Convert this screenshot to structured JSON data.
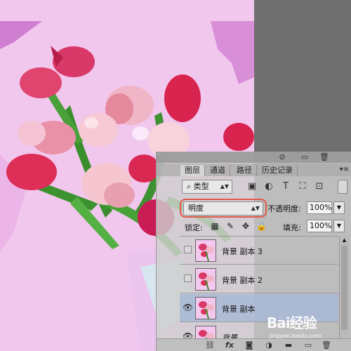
{
  "panel": {
    "tabs": [
      {
        "label": "图层",
        "active": true
      },
      {
        "label": "通道",
        "active": false
      },
      {
        "label": "路径",
        "active": false
      },
      {
        "label": "历史记录",
        "active": false
      }
    ],
    "filter": {
      "label": "类型"
    },
    "blend_mode": "明度",
    "opacity": {
      "label": "不透明度:",
      "value": "100%"
    },
    "lock": {
      "label": "锁定:"
    },
    "fill": {
      "label": "填充:",
      "value": "100%"
    },
    "layers": [
      {
        "name": "背景 副本 3",
        "visible": false,
        "selected": false,
        "italic": false
      },
      {
        "name": "背景 副本 2",
        "visible": false,
        "selected": false,
        "italic": false
      },
      {
        "name": "背景 副本",
        "visible": true,
        "selected": true,
        "italic": false
      },
      {
        "name": "背景",
        "visible": true,
        "selected": false,
        "italic": true
      }
    ],
    "bottom_icons": [
      "link-icon",
      "fx-icon",
      "mask-icon",
      "adjustment-icon",
      "folder-icon",
      "new-layer-icon",
      "trash-icon"
    ],
    "fx_label": "fx"
  },
  "watermark": {
    "main": "Bai经验",
    "sub": "jingyan.baidu.com"
  },
  "colors": {
    "highlight": "#e0574a",
    "selected_layer": "#a8b9d6",
    "canvas_bg": "#f2c7ee"
  }
}
